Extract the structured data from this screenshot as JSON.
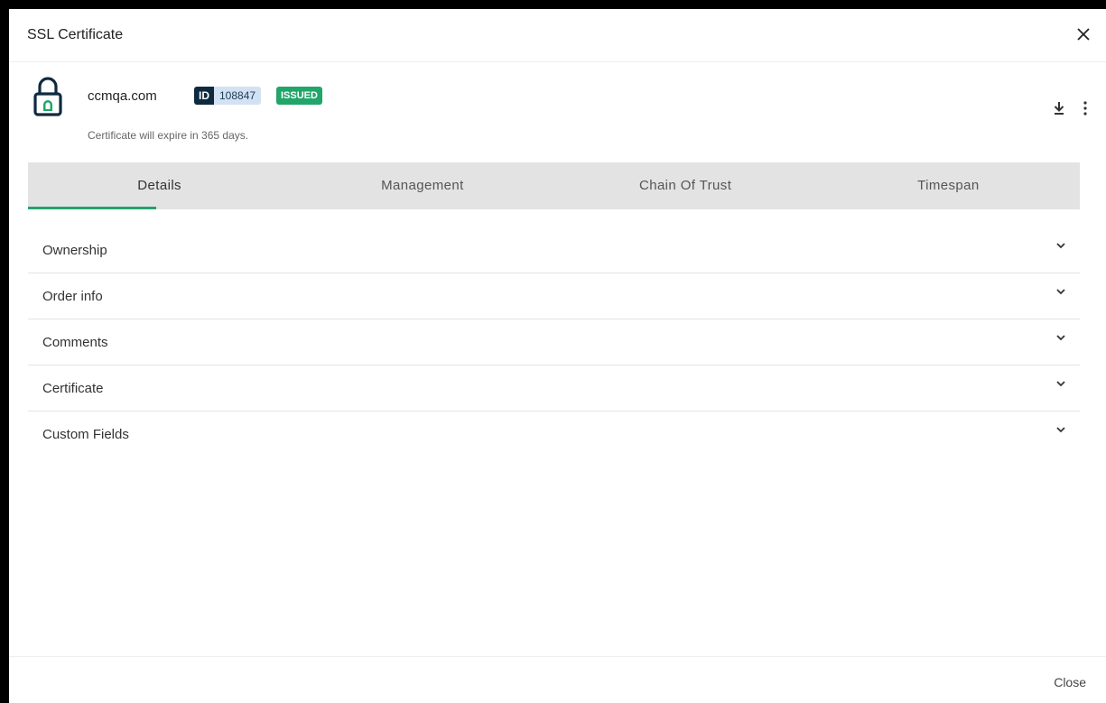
{
  "dialog": {
    "title": "SSL Certificate",
    "close_icon": "close-icon"
  },
  "certificate": {
    "domain": "ccmqa.com",
    "id_label": "ID",
    "id_value": "108847",
    "status": "ISSUED",
    "expiry_text": "Certificate will expire in 365 days.",
    "lock_icon": "lock-icon",
    "actions": [
      "download-icon",
      "more-vertical-icon"
    ]
  },
  "tabs": [
    {
      "label": "Details",
      "active": true
    },
    {
      "label": "Management",
      "active": false
    },
    {
      "label": "Chain Of Trust",
      "active": false
    },
    {
      "label": "Timespan",
      "active": false
    }
  ],
  "sections": [
    {
      "label": "Ownership"
    },
    {
      "label": "Order info"
    },
    {
      "label": "Comments"
    },
    {
      "label": "Certificate"
    },
    {
      "label": "Custom Fields"
    }
  ],
  "footer": {
    "close_label": "Close"
  },
  "colors": {
    "accent": "#21a56a",
    "id_badge_dark": "#0f2a3f",
    "id_badge_light": "#d2e2f3",
    "tab_bar": "#e3e3e3"
  }
}
